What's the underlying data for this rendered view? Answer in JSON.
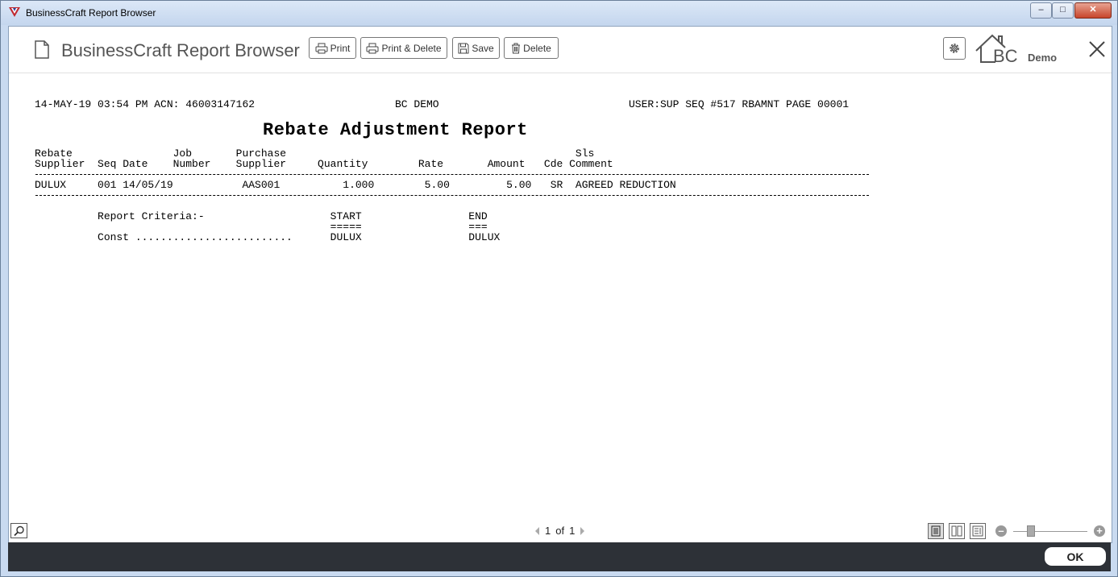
{
  "window": {
    "title": "BusinessCraft Report Browser",
    "min": "–",
    "max": "□",
    "close": "✕"
  },
  "header": {
    "app_title": "BusinessCraft Report Browser",
    "buttons": {
      "print": "Print",
      "print_delete": "Print & Delete",
      "save": "Save",
      "delete": "Delete"
    },
    "logo_text": "BC",
    "demo_label": "Demo"
  },
  "report": {
    "header_left": "14-MAY-19 03:54 PM ACN: 46003147162",
    "header_center": "BC DEMO",
    "header_right": "USER:SUP SEQ #517 RBAMNT PAGE 00001",
    "title": "Rebate Adjustment Report",
    "columns_line1": "Rebate                Job       Purchase                                              Sls",
    "columns_line2": "Supplier  Seq Date    Number    Supplier     Quantity        Rate       Amount   Cde Comment",
    "rows": [
      "DULUX     001 14/05/19           AAS001          1.000        5.00         5.00   SR  AGREED REDUCTION"
    ],
    "criteria_line1": "          Report Criteria:-                    START                 END",
    "criteria_line2": "                                               =====                 ===",
    "criteria_line3": "          Const .........................      DULUX                 DULUX"
  },
  "footer": {
    "page_current": "1",
    "page_of": "of",
    "page_total": "1"
  },
  "bottom": {
    "ok_label": "OK"
  }
}
